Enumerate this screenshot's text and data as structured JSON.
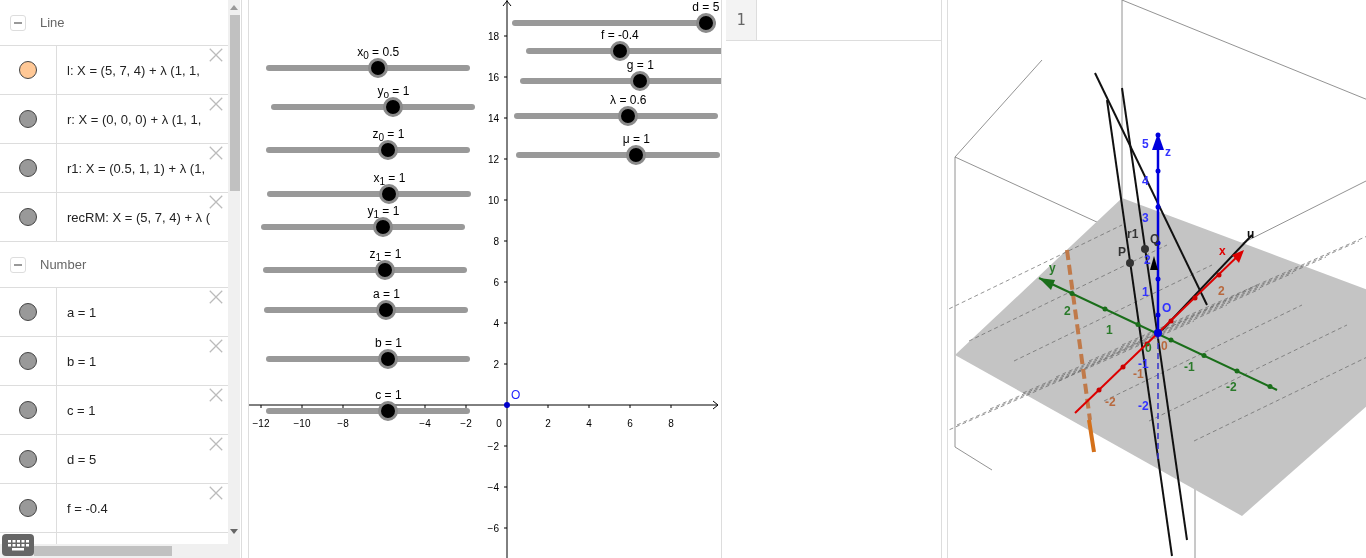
{
  "algebra": {
    "groups": [
      {
        "title": "Line",
        "expanded": true,
        "items": [
          {
            "text": "l: X = (5, 7, 4) + λ (1, 1,",
            "color": "#ffc896"
          },
          {
            "text": "r: X = (0, 0, 0) + λ (1, 1,",
            "color": "#999999"
          },
          {
            "text": "r1: X = (0.5, 1, 1) + λ (1,",
            "color": "#999999"
          },
          {
            "text": "recRM: X = (5, 7, 4) + λ (",
            "color": "#999999"
          }
        ]
      },
      {
        "title": "Number",
        "expanded": true,
        "items": [
          {
            "text": "a = 1",
            "color": "#999999"
          },
          {
            "text": "b = 1",
            "color": "#999999"
          },
          {
            "text": "c = 1",
            "color": "#999999"
          },
          {
            "text": "d = 5",
            "color": "#999999"
          },
          {
            "text": "f = -0.4",
            "color": "#999999"
          }
        ]
      }
    ]
  },
  "graphics": {
    "sliders": [
      {
        "label": "x$_{0}$ = 0.5",
        "level": 0.55
      },
      {
        "label": "y$_{o}$ = 1",
        "level": 0.6
      },
      {
        "label": "z$_{0}$ = 1",
        "level": 0.6
      },
      {
        "label": "x$_{1}$ = 1",
        "level": 0.6
      },
      {
        "label": "y$_{1}$ = 1",
        "level": 0.6
      },
      {
        "label": "z$_{1}$ = 1",
        "level": 0.6
      },
      {
        "label": "a = 1",
        "level": 0.6
      },
      {
        "label": "b = 1",
        "level": 0.6
      },
      {
        "label": "c = 1",
        "level": 0.6
      },
      {
        "label": "d = 5",
        "level": 0.95
      },
      {
        "label": "f = -0.4",
        "level": 0.46
      },
      {
        "label": "g = 1",
        "level": 0.59
      },
      {
        "label": "λ = 0.6",
        "level": 0.56
      },
      {
        "label": "μ = 1",
        "level": 0.59
      }
    ],
    "x_tick_labels": [
      "−12",
      "−10",
      "−8",
      "−4",
      "−2",
      "0",
      "2",
      "4",
      "6",
      "8"
    ],
    "y_tick_labels": [
      "18",
      "16",
      "14",
      "12",
      "10",
      "8",
      "6",
      "4",
      "2",
      "−2",
      "−4",
      "−6"
    ],
    "point_label": "O"
  },
  "spreadsheet": {
    "row_headers": [
      "1"
    ]
  },
  "view_3d": {
    "labels": [
      {
        "text": "z",
        "color": "#3333ff"
      },
      {
        "text": "5",
        "color": "#3333ff"
      },
      {
        "text": "4",
        "color": "#3333ff"
      },
      {
        "text": "3",
        "color": "#3333ff"
      },
      {
        "text": "2",
        "color": "#3333ff"
      },
      {
        "text": "1",
        "color": "#3333ff"
      },
      {
        "text": "-1",
        "color": "#3333ff"
      },
      {
        "text": "-2",
        "color": "#3333ff"
      },
      {
        "text": "x",
        "color": "#e00000"
      },
      {
        "text": "2",
        "color": "#b8693e"
      },
      {
        "text": "0",
        "color": "#b8693e"
      },
      {
        "text": "-1",
        "color": "#b8693e"
      },
      {
        "text": "-2",
        "color": "#b8693e"
      },
      {
        "text": "y",
        "color": "#2a7a2a"
      },
      {
        "text": "2",
        "color": "#2a7a2a"
      },
      {
        "text": "1",
        "color": "#2a7a2a"
      },
      {
        "text": "0",
        "color": "#2a7a2a"
      },
      {
        "text": "-1",
        "color": "#2a7a2a"
      },
      {
        "text": "-2",
        "color": "#2a7a2a"
      },
      {
        "text": "r1",
        "color": "#333333"
      },
      {
        "text": "Q",
        "color": "#333333"
      },
      {
        "text": "P",
        "color": "#333333"
      },
      {
        "text": "u",
        "color": "#111111"
      },
      {
        "text": "O",
        "color": "#3333ff"
      }
    ]
  }
}
